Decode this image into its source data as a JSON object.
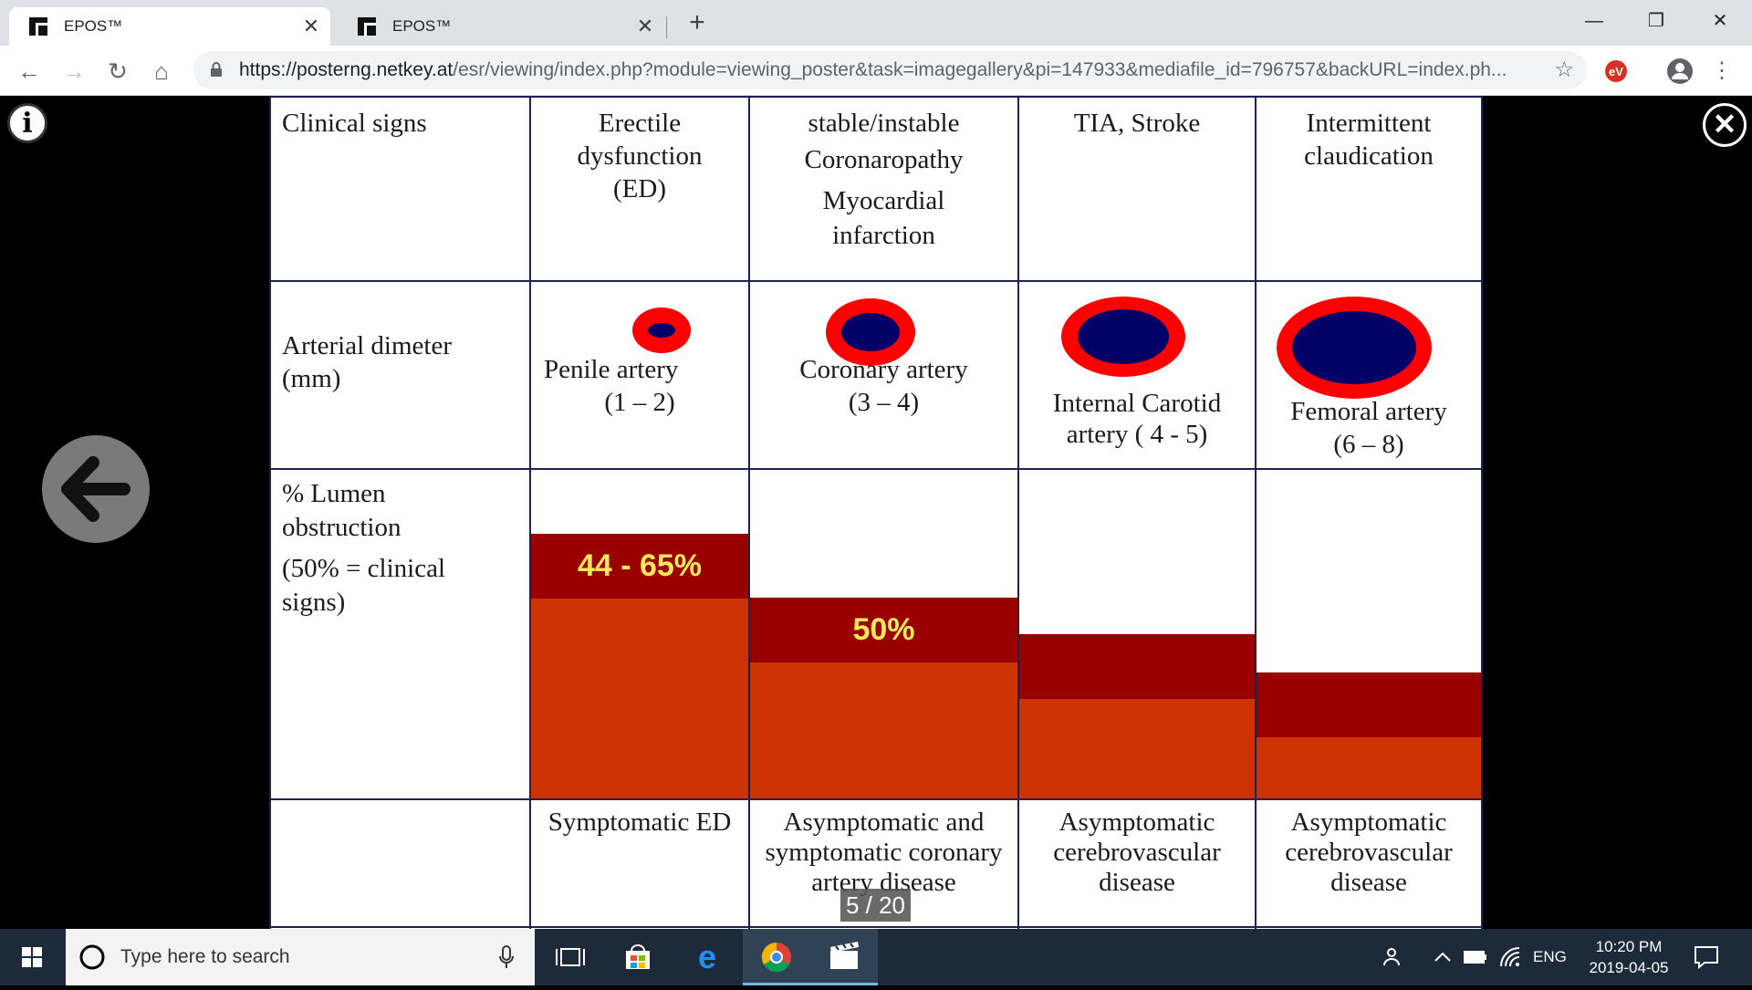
{
  "browser": {
    "tabs": [
      {
        "title": "EPOS™",
        "active": true
      },
      {
        "title": "EPOS™",
        "active": false
      }
    ],
    "new_tab": "+",
    "url_domain": "https://posterng.netkey.at",
    "url_path": "/esr/viewing/index.php?module=viewing_poster&task=imagegallery&pi=147933&mediafile_id=796757&backURL=index.ph...",
    "colors": {
      "tabbar": "#dee1e6",
      "toolbar": "#ffffff"
    }
  },
  "viewer": {
    "counter": "5 / 20",
    "icons": [
      "info-icon",
      "close-icon",
      "back-arrow-icon"
    ]
  },
  "slide": {
    "header": {
      "clinical_signs": "Clinical signs",
      "col1": [
        "Erectile",
        "dysfunction",
        "(ED)"
      ],
      "col2": [
        "stable/instable",
        "Coronaropathy",
        "Myocardial",
        "infarction"
      ],
      "col3": [
        "TIA, Stroke"
      ],
      "col4": [
        "Intermittent",
        "claudication"
      ]
    },
    "row2": {
      "label": [
        "Arterial dimeter",
        "(mm)"
      ],
      "col1": [
        "Penile artery",
        "(1 – 2)"
      ],
      "col2": [
        "Coronary artery",
        "(3 – 4)"
      ],
      "col3": [
        "Internal Carotid",
        "artery ( 4 - 5)"
      ],
      "col4": [
        "Femoral artery",
        "(6 – 8)"
      ]
    },
    "row3": {
      "label": [
        "% Lumen",
        "obstruction",
        "(50% = clinical",
        "signs)"
      ],
      "bar_labels": [
        "44 - 65%",
        "50%",
        "",
        ""
      ],
      "colors": {
        "top_band": "#990000",
        "bottom_band": "#cc3300",
        "label": "#fde85b",
        "artery_wall": "#ff0000",
        "lumen": "#000066"
      }
    },
    "row4": {
      "col1": [
        "Symptomatic ED"
      ],
      "col2": [
        "Asymptomatic and",
        "symptomatic coronary",
        "artery disease"
      ],
      "col3": [
        "Asymptomatic",
        "cerebrovascular",
        "disease"
      ],
      "col4": [
        "Asymptomatic",
        "cerebrovascular",
        "disease"
      ]
    }
  },
  "taskbar": {
    "search_placeholder": "Type here to search",
    "lang": "ENG",
    "time": "10:20 PM",
    "date": "2019-04-05"
  }
}
